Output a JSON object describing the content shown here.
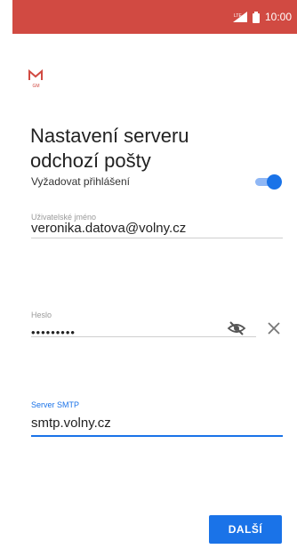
{
  "status_bar": {
    "time": "10:00",
    "signal_label": "LTE"
  },
  "app": {
    "logo_letter": "M",
    "logo_sub": "GM"
  },
  "title": "Nastavení serveru odchozí pošty",
  "require_login": {
    "label": "Vyžadovat přihlášení",
    "enabled": true
  },
  "username": {
    "label": "Uživatelské jméno",
    "value": "veronika.datova@volny.cz"
  },
  "password": {
    "label": "Heslo",
    "masked_value": "•••••••••"
  },
  "smtp": {
    "label": "Server SMTP",
    "value": "smtp.volny.cz"
  },
  "next_button": {
    "label": "DALŠÍ"
  },
  "colors": {
    "status_bar": "#d14a42",
    "accent": "#1a73e8"
  }
}
